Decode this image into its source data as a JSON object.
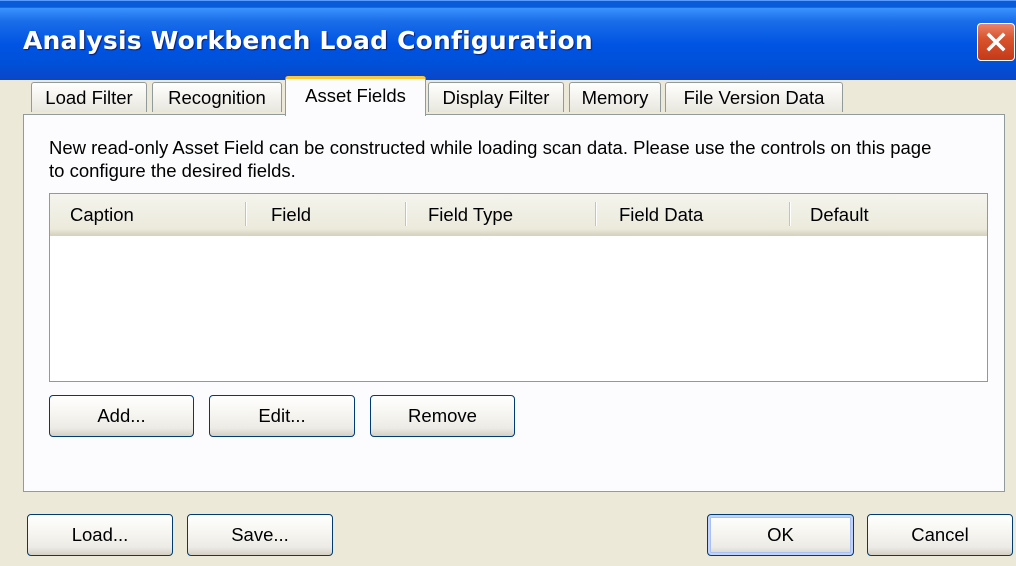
{
  "window": {
    "title": "Analysis Workbench Load Configuration",
    "close_label": "×"
  },
  "tabs": [
    {
      "label": "Load Filter",
      "active": false
    },
    {
      "label": "Recognition",
      "active": false
    },
    {
      "label": "Asset Fields",
      "active": true
    },
    {
      "label": "Display Filter",
      "active": false
    },
    {
      "label": "Memory",
      "active": false
    },
    {
      "label": "File Version Data",
      "active": false
    }
  ],
  "asset_fields": {
    "description": "New read-only Asset Field can be constructed while loading scan data.  Please use the controls on this page to configure the desired fields.",
    "columns": [
      "Caption",
      "Field",
      "Field Type",
      "Field Data",
      "Default"
    ],
    "rows": [],
    "add_label": "Add...",
    "edit_label": "Edit...",
    "remove_label": "Remove"
  },
  "footer": {
    "load_label": "Load...",
    "save_label": "Save...",
    "ok_label": "OK",
    "cancel_label": "Cancel"
  },
  "colors": {
    "titlebar": "#0054e3",
    "dialog_bg": "#ece9d8",
    "active_tab_highlight": "#ffc83c",
    "button_border": "#003c74",
    "close_button": "#d8542e"
  },
  "icons": {
    "close": "close-icon"
  }
}
